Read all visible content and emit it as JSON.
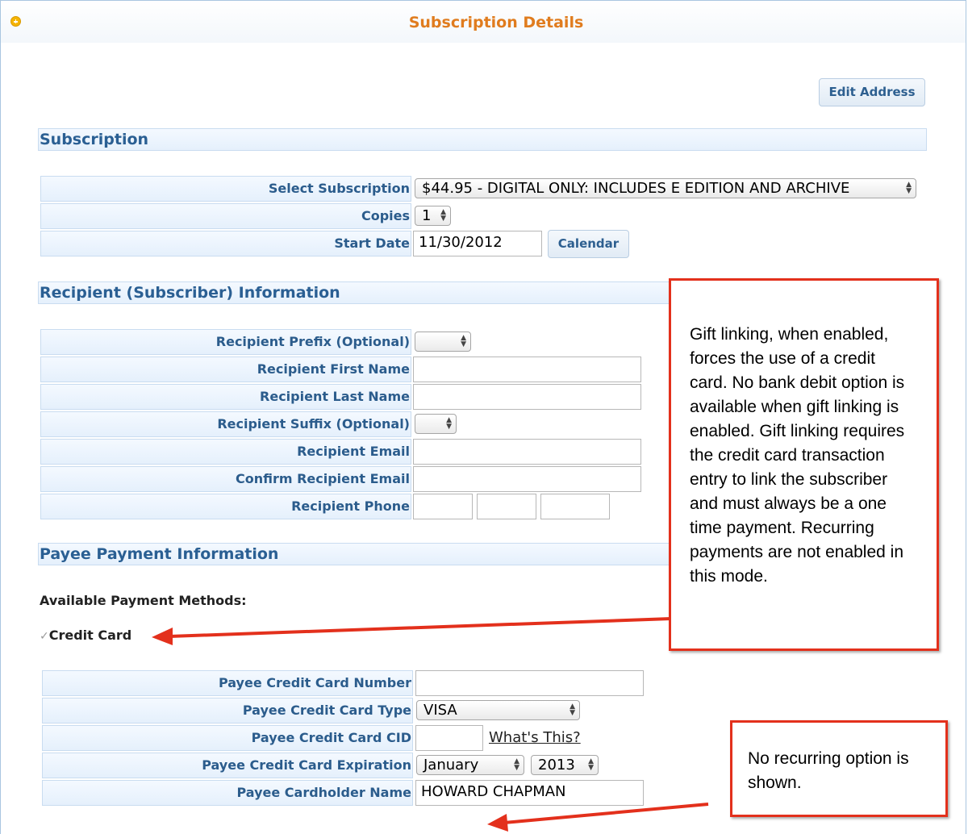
{
  "header": {
    "title": "Subscription Details"
  },
  "buttons": {
    "edit_address": "Edit Address",
    "calendar": "Calendar"
  },
  "sections": {
    "subscription": "Subscription",
    "recipient": "Recipient (Subscriber) Information",
    "payee": "Payee Payment Information"
  },
  "subscription": {
    "select_label": "Select Subscription",
    "select_value": "$44.95 - DIGITAL ONLY: INCLUDES E EDITION AND ARCHIVE",
    "copies_label": "Copies",
    "copies_value": "1",
    "start_label": "Start Date",
    "start_value": "11/30/2012"
  },
  "recipient": {
    "prefix_label": "Recipient Prefix (Optional)",
    "first_label": "Recipient First Name",
    "last_label": "Recipient Last Name",
    "suffix_label": "Recipient Suffix (Optional)",
    "email_label": "Recipient Email",
    "confirm_email_label": "Confirm Recipient Email",
    "phone_label": "Recipient Phone"
  },
  "payment": {
    "methods_label": "Available Payment Methods:",
    "credit_card_option": "Credit Card",
    "check_mark": "✓",
    "cc_number_label": "Payee Credit Card Number",
    "cc_type_label": "Payee Credit Card Type",
    "cc_type_value": "VISA",
    "cid_label": "Payee Credit Card CID",
    "whats_this": "What's This?",
    "exp_label": "Payee Credit Card Expiration",
    "exp_month": "January",
    "exp_year": "2013",
    "holder_label": "Payee Cardholder Name",
    "holder_value": "HOWARD CHAPMAN"
  },
  "annotations": {
    "gift_note": "Gift linking, when enabled, forces the use of a credit card.  No bank debit option is available when gift linking is enabled.  Gift linking requires the credit card transaction entry to link the subscriber and must always be a one time payment.  Recurring payments are not enabled in this mode.",
    "recurring_note": "No recurring option is shown."
  },
  "colors": {
    "title": "#e07c1e",
    "section_text": "#2a5f93",
    "annotation_border": "#e3301c"
  }
}
